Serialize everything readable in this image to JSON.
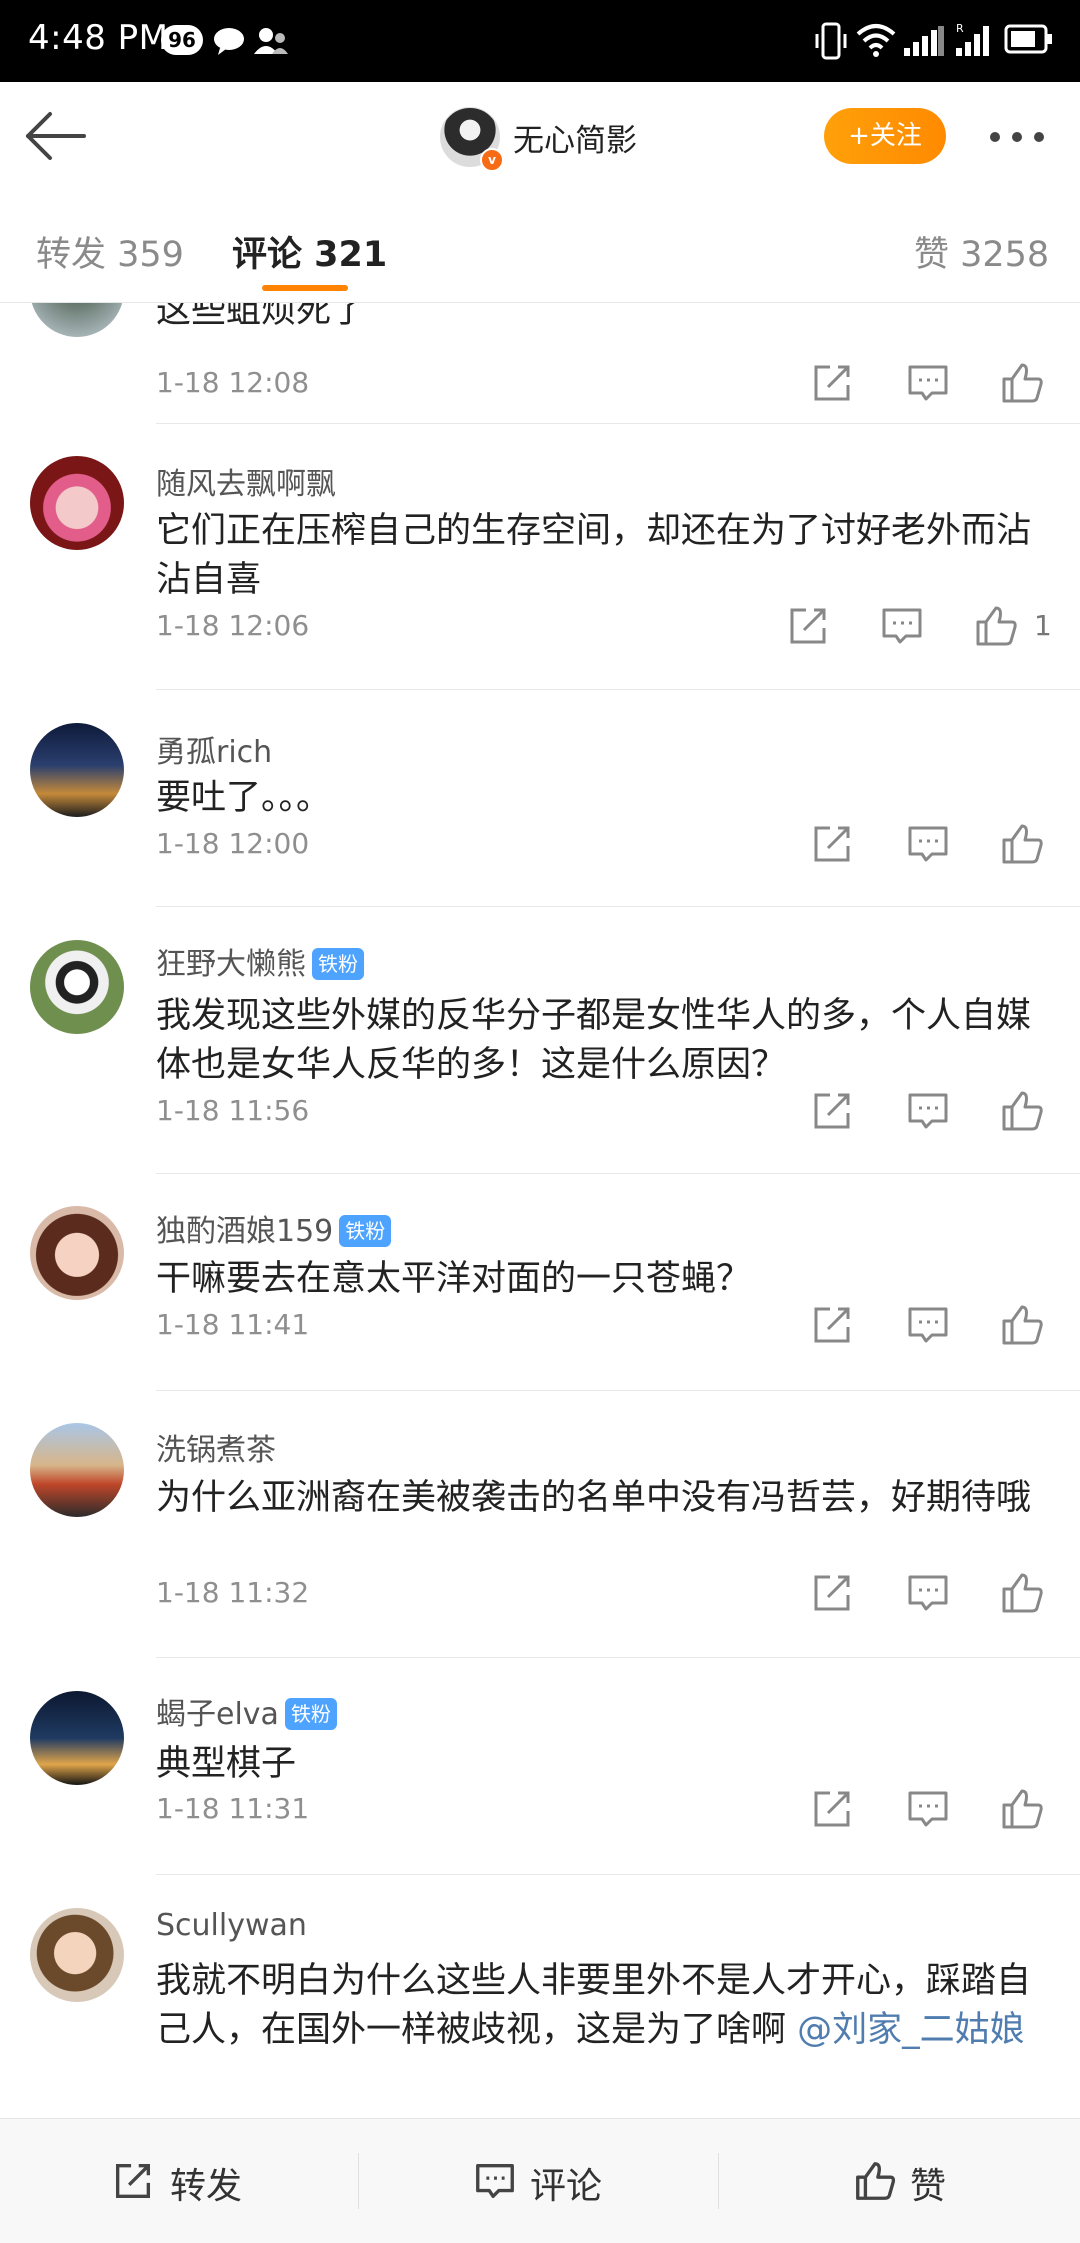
{
  "status_bar": {
    "time": "4:48 PM",
    "notification_count": "96",
    "icons": [
      "chat-bubble-icon",
      "contacts-icon",
      "vibrate-icon",
      "wifi-icon",
      "signal-icon",
      "signal-roaming-icon",
      "battery-icon"
    ]
  },
  "header": {
    "user_name": "无心简影",
    "follow_label": "+关注",
    "verified_badge": "v"
  },
  "tabs": [
    {
      "label": "转发 359",
      "active": false
    },
    {
      "label": "评论 321",
      "active": true
    },
    {
      "label": "赞 3258",
      "active": false
    }
  ],
  "comments": [
    {
      "username": "",
      "badge": "",
      "text": "这些蛆烦死了",
      "time": "1-18 12:08",
      "likes": ""
    },
    {
      "username": "随风去飘啊飘",
      "badge": "",
      "text": "它们正在压榨自己的生存空间，却还在为了讨好老外而沾沾自喜",
      "time": "1-18 12:06",
      "likes": "1"
    },
    {
      "username": "勇孤rich",
      "badge": "",
      "text": "要吐了。。。",
      "time": "1-18 12:00",
      "likes": ""
    },
    {
      "username": "狂野大懒熊",
      "badge": "铁粉",
      "text": "我发现这些外媒的反华分子都是女性华人的多，个人自媒体也是女华人反华的多！这是什么原因？",
      "time": "1-18 11:56",
      "likes": ""
    },
    {
      "username": "独酌酒娘159",
      "badge": "铁粉",
      "text": "干嘛要去在意太平洋对面的一只苍蝇？",
      "time": "1-18 11:41",
      "likes": ""
    },
    {
      "username": "洗锅煮茶",
      "badge": "",
      "text": "为什么亚洲裔在美被袭击的名单中没有冯哲芸，好期待哦",
      "time": "1-18 11:32",
      "likes": ""
    },
    {
      "username": "蝎子elva",
      "badge": "铁粉",
      "text": "典型棋子",
      "time": "1-18 11:31",
      "likes": ""
    },
    {
      "username": "Scullywan",
      "badge": "",
      "text": "我就不明白为什么这些人非要里外不是人才开心，踩踏自己人，在国外一样被歧视，这是为了啥啊 ",
      "mention": "@刘家_二姑娘",
      "time": "",
      "likes": ""
    }
  ],
  "bottom_bar": {
    "repost_label": "转发",
    "comment_label": "评论",
    "like_label": "赞"
  },
  "colors": {
    "accent_orange": "#ff8200",
    "fan_badge_blue": "#4ea3ff",
    "mention_blue": "#507daf"
  }
}
